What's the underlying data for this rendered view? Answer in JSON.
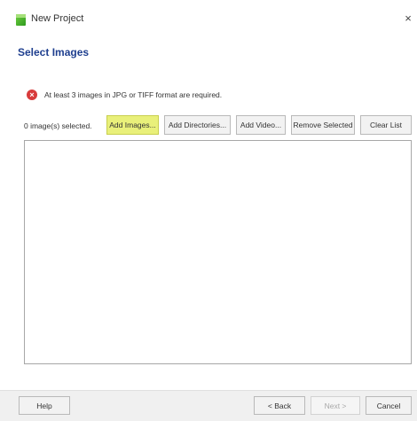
{
  "window": {
    "title": "New Project",
    "close_glyph": "×",
    "app_icon": "app-logo-icon"
  },
  "page": {
    "section_title": "Select Images",
    "error": {
      "icon": "error-icon",
      "icon_glyph": "×",
      "message": "At least 3 images in JPG or TIFF format are required."
    }
  },
  "toolbar": {
    "count_label": "0 image(s) selected.",
    "add_images": "Add Images...",
    "add_directories": "Add Directories...",
    "add_video": "Add Video...",
    "remove_selected": "Remove Selected",
    "clear_list": "Clear List"
  },
  "footer": {
    "help": "Help",
    "back": "< Back",
    "next": "Next >",
    "cancel": "Cancel"
  },
  "colors": {
    "highlight": "#e9f07a",
    "section_title": "#1f3f8f",
    "error": "#d83b3b"
  }
}
